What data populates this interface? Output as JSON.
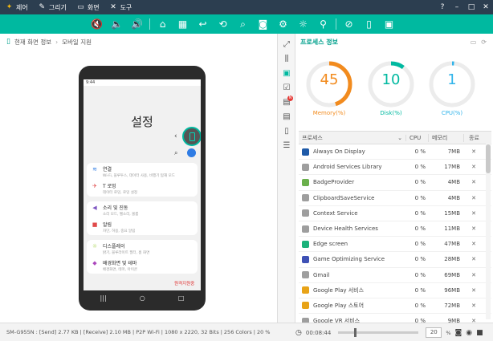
{
  "titlebar": {
    "menus": [
      {
        "label": "제어",
        "icon": "wand-icon"
      },
      {
        "label": "그리기",
        "icon": "pencil-icon"
      },
      {
        "label": "화면",
        "icon": "monitor-icon"
      },
      {
        "label": "도구",
        "icon": "tools-icon"
      }
    ],
    "help": "?",
    "minimize": "–",
    "maximize": "□",
    "close": "✕"
  },
  "toolbar": {
    "tools": [
      "volume-mute-icon",
      "volume-down-icon",
      "volume-up-icon",
      "home-icon",
      "apps-icon",
      "back-icon",
      "rotate-icon",
      "search-icon",
      "camera-icon",
      "settings-icon",
      "brightness-icon",
      "pin-icon",
      "no-link-icon",
      "phone-portrait-icon",
      "phone-remote-icon"
    ]
  },
  "left": {
    "breadcrumb": [
      "현재 화면 정보",
      "모바일 지원"
    ],
    "phone": {
      "status_time": "9:44",
      "title": "설정",
      "remote_label": "원격지원중",
      "menu_groups": [
        [
          {
            "title": "연결",
            "sub": "Wi-Fi, 블루투스, 데이터 사용, 비행기 탑재 모드"
          },
          {
            "title": "T 로밍",
            "sub": "데이터 로밍, 로밍 설정"
          }
        ],
        [
          {
            "title": "소리 및 진동",
            "sub": "소리 모드, 벨소리, 볼륨"
          },
          {
            "title": "알림",
            "sub": "차단, 허용, 중요 알림"
          }
        ],
        [
          {
            "title": "디스플레이",
            "sub": "밝기, 블루라이트 필터, 홈 화면"
          },
          {
            "title": "배경화면 및 테마",
            "sub": "배경화면, 테마, 아이콘"
          }
        ]
      ]
    }
  },
  "right": {
    "title": "프로세스 정보",
    "gauges": [
      {
        "value": "45",
        "label": "Memory(%)",
        "percent": 45,
        "color": "#f28b1e"
      },
      {
        "value": "10",
        "label": "Disk(%)",
        "percent": 10,
        "color": "#00b9a0"
      },
      {
        "value": "1",
        "label": "CPU(%)",
        "percent": 1,
        "color": "#2fb3ea"
      }
    ],
    "columns": {
      "name": "프로세스",
      "cpu": "CPU",
      "mem": "메모리",
      "end": "종료"
    },
    "processes": [
      {
        "name": "Always On Display",
        "cpu": "0 %",
        "mem": "7MB",
        "color": "#1e5aa8"
      },
      {
        "name": "Android Services Library",
        "cpu": "0 %",
        "mem": "17MB",
        "color": "#9e9e9e"
      },
      {
        "name": "BadgeProvider",
        "cpu": "0 %",
        "mem": "4MB",
        "color": "#6ab04c"
      },
      {
        "name": "ClipboardSaveService",
        "cpu": "0 %",
        "mem": "4MB",
        "color": "#9e9e9e"
      },
      {
        "name": "Context Service",
        "cpu": "0 %",
        "mem": "15MB",
        "color": "#9e9e9e"
      },
      {
        "name": "Device Health Services",
        "cpu": "0 %",
        "mem": "11MB",
        "color": "#9e9e9e"
      },
      {
        "name": "Edge screen",
        "cpu": "0 %",
        "mem": "47MB",
        "color": "#1bb27a"
      },
      {
        "name": "Game Optimizing Service",
        "cpu": "0 %",
        "mem": "28MB",
        "color": "#3f51b5"
      },
      {
        "name": "Gmail",
        "cpu": "0 %",
        "mem": "69MB",
        "color": "#9e9e9e"
      },
      {
        "name": "Google  Play 서비스",
        "cpu": "0 %",
        "mem": "96MB",
        "color": "#e8a317"
      },
      {
        "name": "Google  Play 스토어",
        "cpu": "0 %",
        "mem": "72MB",
        "color": "#e8a317"
      },
      {
        "name": "Google VR 서비스",
        "cpu": "0 %",
        "mem": "9MB",
        "color": "#9e9e9e"
      }
    ]
  },
  "status": {
    "device": "SM-G955N",
    "send": "[Send] 2.77 KB",
    "receive": "[Receive] 2.10 MB",
    "conn": "P2P Wi-Fi",
    "resolution": "1080 x 2220, 32 Bits",
    "colors": "256 Colors",
    "percent": "20 %",
    "timer": "00:08:44",
    "zoom": "20",
    "zoom_unit": "%"
  }
}
